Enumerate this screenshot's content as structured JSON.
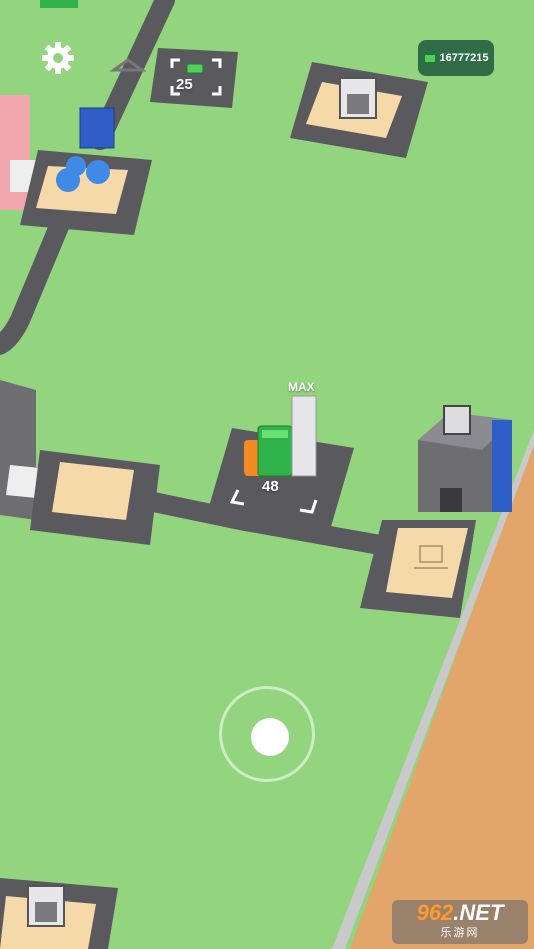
{
  "hud": {
    "money": "16777215",
    "settings_icon": "gear-icon",
    "money_icon": "cash-icon"
  },
  "world": {
    "upgrade_pad_cost": "25",
    "unlock_pad_cost": "48",
    "stack_label": "MAX"
  },
  "joystick": {
    "icon": "joystick"
  },
  "watermark": {
    "number": "962",
    "suffix": ".NET",
    "subtitle": "乐游网"
  },
  "colors": {
    "grass": "#93d47e",
    "road": "#5a5a5e",
    "pad": "#f6d9a8",
    "sand": "#e2a66b",
    "money_badge": "#2e6d45"
  }
}
